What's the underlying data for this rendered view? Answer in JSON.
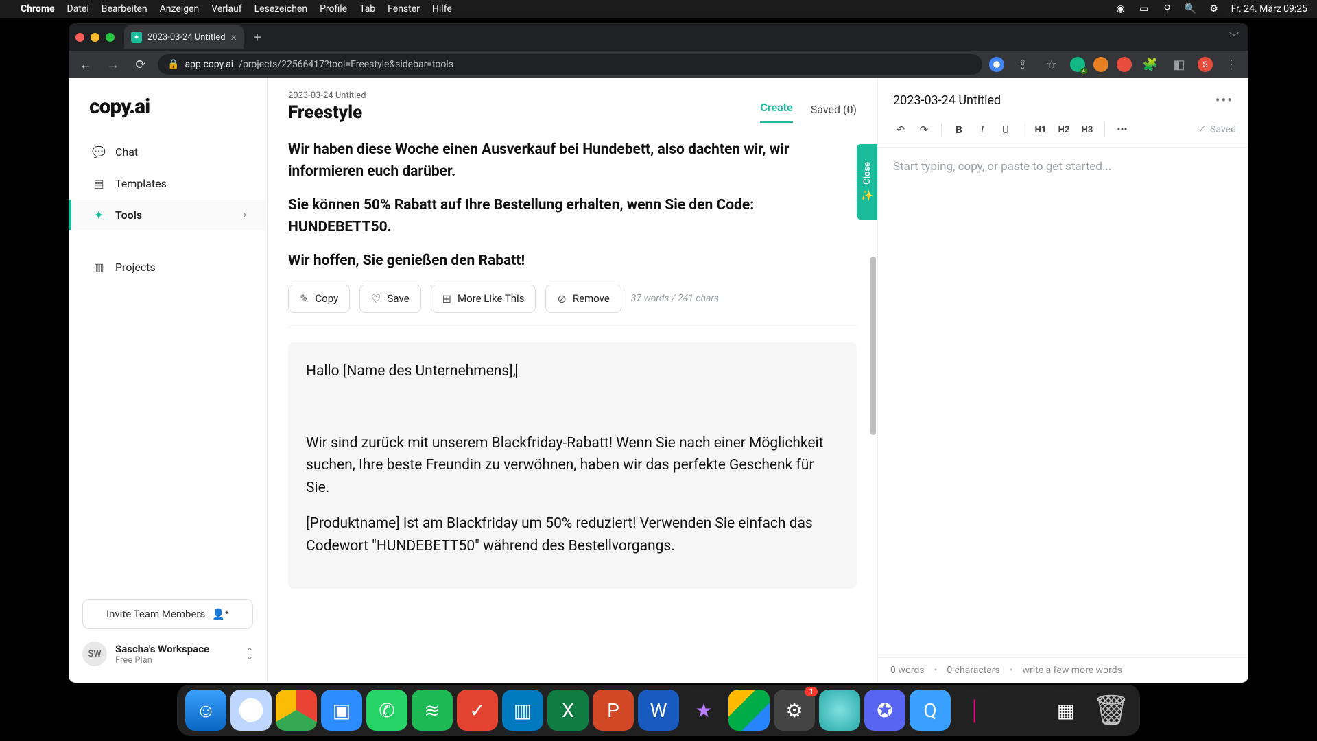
{
  "menubar": {
    "app": "Chrome",
    "items": [
      "Datei",
      "Bearbeiten",
      "Anzeigen",
      "Verlauf",
      "Lesezeichen",
      "Profile",
      "Tab",
      "Fenster",
      "Hilfe"
    ],
    "clock": "Fr. 24. März  09:25"
  },
  "browser": {
    "tab_title": "2023-03-24 Untitled",
    "url_host": "app.copy.ai",
    "url_path": "/projects/22566417?tool=Freestyle&sidebar=tools"
  },
  "sidebar": {
    "logo_a": "copy",
    "logo_b": ".ai",
    "items": [
      {
        "label": "Chat"
      },
      {
        "label": "Templates"
      },
      {
        "label": "Tools",
        "active": true,
        "chevron": true
      },
      {
        "label": "Projects"
      }
    ],
    "invite": "Invite Team Members",
    "workspace": {
      "initials": "SW",
      "name": "Sascha's Workspace",
      "plan": "Free Plan"
    }
  },
  "center": {
    "breadcrumb": "2023-03-24 Untitled",
    "tool": "Freestyle",
    "tabs": {
      "create": "Create",
      "saved": "Saved (0)"
    },
    "close_label": "Close",
    "result1": {
      "p1": "Wir haben diese Woche einen Ausverkauf bei Hundebett, also dachten wir, wir informieren euch darüber.",
      "p2": "Sie können 50% Rabatt auf Ihre Bestellung erhalten, wenn Sie den Code: HUNDEBETT50.",
      "p3": "Wir hoffen, Sie genießen den Rabatt!",
      "copy": "Copy",
      "save": "Save",
      "more": "More Like This",
      "remove": "Remove",
      "count": "37 words / 241 chars"
    },
    "result2": {
      "p1": "Hallo [Name des Unternehmens],",
      "p2": "Wir sind zurück mit unserem Blackfriday-Rabatt! Wenn Sie nach einer Möglichkeit suchen, Ihre beste Freundin zu verwöhnen, haben wir das perfekte Geschenk für Sie.",
      "p3": "[Produktname] ist am Blackfriday um 50% reduziert! Verwenden Sie einfach das Codewort \"HUNDEBETT50\" während des Bestellvorgangs."
    }
  },
  "rightp": {
    "title": "2023-03-24 Untitled",
    "toolbar": {
      "b": "B",
      "i": "I",
      "u": "U",
      "h1": "H1",
      "h2": "H2",
      "h3": "H3",
      "more": "•••",
      "saved": "Saved"
    },
    "placeholder": "Start typing, copy, or paste to get started...",
    "footer": {
      "words": "0 words",
      "chars": "0 characters",
      "hint": "write a few more words"
    }
  },
  "dock": {
    "settings_badge": "1"
  }
}
